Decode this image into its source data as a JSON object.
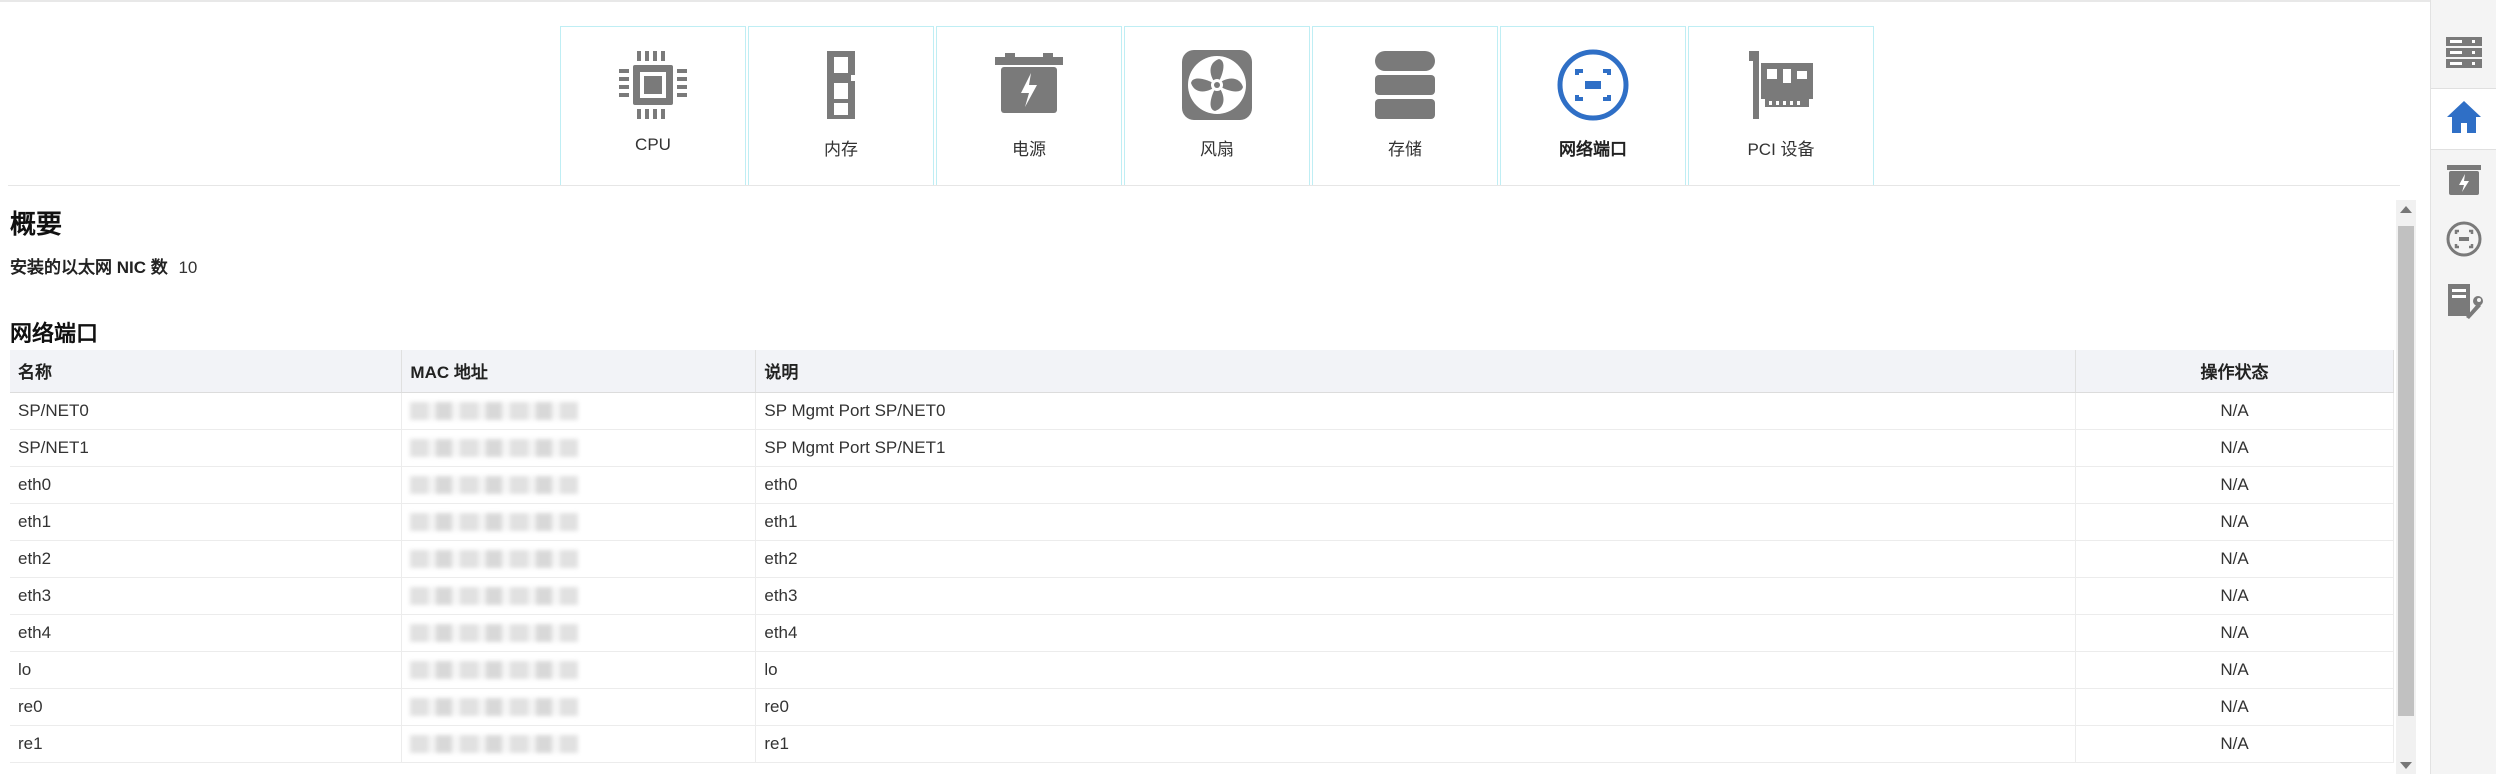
{
  "tiles": [
    {
      "label": "CPU",
      "icon": "cpu-icon"
    },
    {
      "label": "内存",
      "icon": "memory-icon"
    },
    {
      "label": "电源",
      "icon": "power-supply-icon"
    },
    {
      "label": "风扇",
      "icon": "fan-icon"
    },
    {
      "label": "存储",
      "icon": "storage-icon"
    },
    {
      "label": "网络端口",
      "icon": "network-port-icon",
      "active": true
    },
    {
      "label": "PCI 设备",
      "icon": "pci-device-icon"
    }
  ],
  "summary": {
    "heading": "概要",
    "nic_label": "安装的以太网 NIC 数",
    "nic_count": "10"
  },
  "ports": {
    "heading": "网络端口",
    "columns": [
      "名称",
      "MAC 地址",
      "说明",
      "操作状态"
    ],
    "rows": [
      {
        "name": "SP/NET0",
        "description": "SP Mgmt Port SP/NET0",
        "status": "N/A"
      },
      {
        "name": "SP/NET1",
        "description": "SP Mgmt Port SP/NET1",
        "status": "N/A"
      },
      {
        "name": "eth0",
        "description": "eth0",
        "status": "N/A"
      },
      {
        "name": "eth1",
        "description": "eth1",
        "status": "N/A"
      },
      {
        "name": "eth2",
        "description": "eth2",
        "status": "N/A"
      },
      {
        "name": "eth3",
        "description": "eth3",
        "status": "N/A"
      },
      {
        "name": "eth4",
        "description": "eth4",
        "status": "N/A"
      },
      {
        "name": "lo",
        "description": "lo",
        "status": "N/A"
      },
      {
        "name": "re0",
        "description": "re0",
        "status": "N/A"
      },
      {
        "name": "re1",
        "description": "re1",
        "status": "N/A"
      }
    ]
  },
  "sidebar": {
    "items": [
      "server-list-icon",
      "home-icon",
      "power-icon",
      "network-icon",
      "service-tools-icon"
    ],
    "active_index": 1
  },
  "colors": {
    "icon_gray": "#7a7a7a",
    "accent_blue": "#2f6fc6",
    "tile_border": "#bfeef4"
  }
}
